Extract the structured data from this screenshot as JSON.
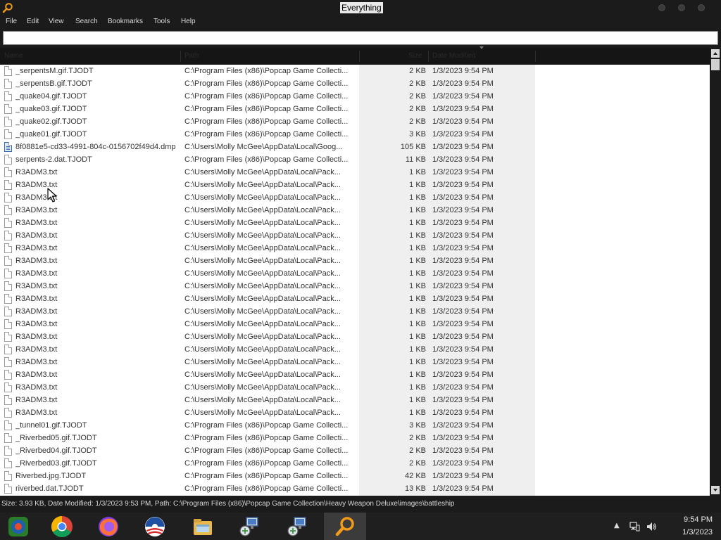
{
  "window": {
    "title": "Everything"
  },
  "menu": [
    "File",
    "Edit",
    "View",
    "Search",
    "Bookmarks",
    "Tools",
    "Help"
  ],
  "search": {
    "value": "",
    "placeholder": ""
  },
  "columns": [
    "Name",
    "Path",
    "Size",
    "Date Modified"
  ],
  "rows": [
    {
      "icon": "file-icon",
      "name": "_serpentsM.gif.TJODT",
      "path": "C:\\Program Files (x86)\\Popcap Game Collecti...",
      "size": "2 KB",
      "date": "1/3/2023 9:54 PM"
    },
    {
      "icon": "file-icon",
      "name": "_serpentsB.gif.TJODT",
      "path": "C:\\Program Files (x86)\\Popcap Game Collecti...",
      "size": "2 KB",
      "date": "1/3/2023 9:54 PM"
    },
    {
      "icon": "file-icon",
      "name": "_quake04.gif.TJODT",
      "path": "C:\\Program Files (x86)\\Popcap Game Collecti...",
      "size": "2 KB",
      "date": "1/3/2023 9:54 PM"
    },
    {
      "icon": "file-icon",
      "name": "_quake03.gif.TJODT",
      "path": "C:\\Program Files (x86)\\Popcap Game Collecti...",
      "size": "2 KB",
      "date": "1/3/2023 9:54 PM"
    },
    {
      "icon": "file-icon",
      "name": "_quake02.gif.TJODT",
      "path": "C:\\Program Files (x86)\\Popcap Game Collecti...",
      "size": "2 KB",
      "date": "1/3/2023 9:54 PM"
    },
    {
      "icon": "file-icon",
      "name": "_quake01.gif.TJODT",
      "path": "C:\\Program Files (x86)\\Popcap Game Collecti...",
      "size": "3 KB",
      "date": "1/3/2023 9:54 PM"
    },
    {
      "icon": "dump-file-icon",
      "name": "8f0881e5-cd33-4991-804c-0156702f49d4.dmp",
      "path": "C:\\Users\\Molly McGee\\AppData\\Local\\Goog...",
      "size": "105 KB",
      "date": "1/3/2023 9:54 PM"
    },
    {
      "icon": "file-icon",
      "name": "serpents-2.dat.TJODT",
      "path": "C:\\Program Files (x86)\\Popcap Game Collecti...",
      "size": "11 KB",
      "date": "1/3/2023 9:54 PM"
    },
    {
      "icon": "file-icon",
      "name": "R3ADM3.txt",
      "path": "C:\\Users\\Molly McGee\\AppData\\Local\\Pack...",
      "size": "1 KB",
      "date": "1/3/2023 9:54 PM"
    },
    {
      "icon": "file-icon",
      "name": "R3ADM3.txt",
      "path": "C:\\Users\\Molly McGee\\AppData\\Local\\Pack...",
      "size": "1 KB",
      "date": "1/3/2023 9:54 PM"
    },
    {
      "icon": "file-icon",
      "name": "R3ADM3.txt",
      "path": "C:\\Users\\Molly McGee\\AppData\\Local\\Pack...",
      "size": "1 KB",
      "date": "1/3/2023 9:54 PM"
    },
    {
      "icon": "file-icon",
      "name": "R3ADM3.txt",
      "path": "C:\\Users\\Molly McGee\\AppData\\Local\\Pack...",
      "size": "1 KB",
      "date": "1/3/2023 9:54 PM"
    },
    {
      "icon": "file-icon",
      "name": "R3ADM3.txt",
      "path": "C:\\Users\\Molly McGee\\AppData\\Local\\Pack...",
      "size": "1 KB",
      "date": "1/3/2023 9:54 PM"
    },
    {
      "icon": "file-icon",
      "name": "R3ADM3.txt",
      "path": "C:\\Users\\Molly McGee\\AppData\\Local\\Pack...",
      "size": "1 KB",
      "date": "1/3/2023 9:54 PM"
    },
    {
      "icon": "file-icon",
      "name": "R3ADM3.txt",
      "path": "C:\\Users\\Molly McGee\\AppData\\Local\\Pack...",
      "size": "1 KB",
      "date": "1/3/2023 9:54 PM"
    },
    {
      "icon": "file-icon",
      "name": "R3ADM3.txt",
      "path": "C:\\Users\\Molly McGee\\AppData\\Local\\Pack...",
      "size": "1 KB",
      "date": "1/3/2023 9:54 PM"
    },
    {
      "icon": "file-icon",
      "name": "R3ADM3.txt",
      "path": "C:\\Users\\Molly McGee\\AppData\\Local\\Pack...",
      "size": "1 KB",
      "date": "1/3/2023 9:54 PM"
    },
    {
      "icon": "file-icon",
      "name": "R3ADM3.txt",
      "path": "C:\\Users\\Molly McGee\\AppData\\Local\\Pack...",
      "size": "1 KB",
      "date": "1/3/2023 9:54 PM"
    },
    {
      "icon": "file-icon",
      "name": "R3ADM3.txt",
      "path": "C:\\Users\\Molly McGee\\AppData\\Local\\Pack...",
      "size": "1 KB",
      "date": "1/3/2023 9:54 PM"
    },
    {
      "icon": "file-icon",
      "name": "R3ADM3.txt",
      "path": "C:\\Users\\Molly McGee\\AppData\\Local\\Pack...",
      "size": "1 KB",
      "date": "1/3/2023 9:54 PM"
    },
    {
      "icon": "file-icon",
      "name": "R3ADM3.txt",
      "path": "C:\\Users\\Molly McGee\\AppData\\Local\\Pack...",
      "size": "1 KB",
      "date": "1/3/2023 9:54 PM"
    },
    {
      "icon": "file-icon",
      "name": "R3ADM3.txt",
      "path": "C:\\Users\\Molly McGee\\AppData\\Local\\Pack...",
      "size": "1 KB",
      "date": "1/3/2023 9:54 PM"
    },
    {
      "icon": "file-icon",
      "name": "R3ADM3.txt",
      "path": "C:\\Users\\Molly McGee\\AppData\\Local\\Pack...",
      "size": "1 KB",
      "date": "1/3/2023 9:54 PM"
    },
    {
      "icon": "file-icon",
      "name": "R3ADM3.txt",
      "path": "C:\\Users\\Molly McGee\\AppData\\Local\\Pack...",
      "size": "1 KB",
      "date": "1/3/2023 9:54 PM"
    },
    {
      "icon": "file-icon",
      "name": "R3ADM3.txt",
      "path": "C:\\Users\\Molly McGee\\AppData\\Local\\Pack...",
      "size": "1 KB",
      "date": "1/3/2023 9:54 PM"
    },
    {
      "icon": "file-icon",
      "name": "R3ADM3.txt",
      "path": "C:\\Users\\Molly McGee\\AppData\\Local\\Pack...",
      "size": "1 KB",
      "date": "1/3/2023 9:54 PM"
    },
    {
      "icon": "file-icon",
      "name": "R3ADM3.txt",
      "path": "C:\\Users\\Molly McGee\\AppData\\Local\\Pack...",
      "size": "1 KB",
      "date": "1/3/2023 9:54 PM"
    },
    {
      "icon": "file-icon",
      "name": "R3ADM3.txt",
      "path": "C:\\Users\\Molly McGee\\AppData\\Local\\Pack...",
      "size": "1 KB",
      "date": "1/3/2023 9:54 PM"
    },
    {
      "icon": "file-icon",
      "name": "_tunnel01.gif.TJODT",
      "path": "C:\\Program Files (x86)\\Popcap Game Collecti...",
      "size": "3 KB",
      "date": "1/3/2023 9:54 PM"
    },
    {
      "icon": "file-icon",
      "name": "_Riverbed05.gif.TJODT",
      "path": "C:\\Program Files (x86)\\Popcap Game Collecti...",
      "size": "2 KB",
      "date": "1/3/2023 9:54 PM"
    },
    {
      "icon": "file-icon",
      "name": "_Riverbed04.gif.TJODT",
      "path": "C:\\Program Files (x86)\\Popcap Game Collecti...",
      "size": "2 KB",
      "date": "1/3/2023 9:54 PM"
    },
    {
      "icon": "file-icon",
      "name": "_Riverbed03.gif.TJODT",
      "path": "C:\\Program Files (x86)\\Popcap Game Collecti...",
      "size": "2 KB",
      "date": "1/3/2023 9:54 PM"
    },
    {
      "icon": "file-icon",
      "name": "Riverbed.jpg.TJODT",
      "path": "C:\\Program Files (x86)\\Popcap Game Collecti...",
      "size": "42 KB",
      "date": "1/3/2023 9:54 PM"
    },
    {
      "icon": "file-icon",
      "name": "riverbed.dat.TJODT",
      "path": "C:\\Program Files (x86)\\Popcap Game Collecti...",
      "size": "13 KB",
      "date": "1/3/2023 9:54 PM"
    }
  ],
  "status": {
    "text": "Size: 3.93 KB, Date Modified: 1/3/2023 9:53 PM, Path: C:\\Program Files (x86)\\Popcap Game Collection\\Heavy Weapon Deluxe\\images\\battleship"
  },
  "taskbar": {
    "apps": [
      "media-center-icon",
      "chrome-icon",
      "firefox-icon",
      "obama-logo-icon",
      "file-explorer-icon",
      "network-tool-icon",
      "network-tool-icon",
      "everything-search-icon"
    ],
    "time": "9:54 PM",
    "date": "1/3/2023"
  },
  "colors": {
    "chrome_bg": "#1b1b1b",
    "accent_orange": "#f29a1a"
  }
}
